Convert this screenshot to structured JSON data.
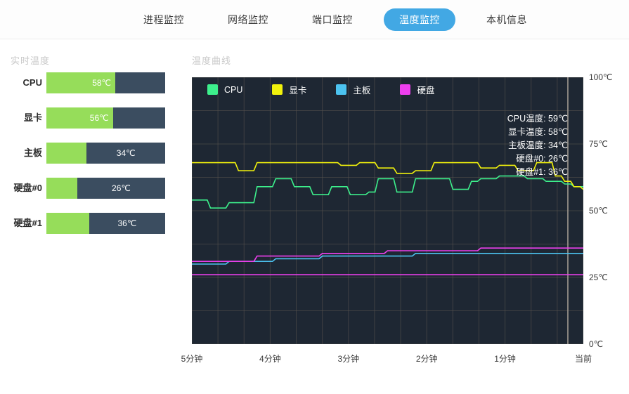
{
  "nav": {
    "items": [
      {
        "label": "进程监控",
        "active": false
      },
      {
        "label": "网络监控",
        "active": false
      },
      {
        "label": "端口监控",
        "active": false
      },
      {
        "label": "温度监控",
        "active": true
      },
      {
        "label": "本机信息",
        "active": false
      }
    ],
    "active_color": "#42a8e4"
  },
  "sidebar": {
    "title": "实时温度",
    "bar_fill_color": "#96dd5a",
    "bar_track_color": "#3b4d60",
    "bars": [
      {
        "label": "CPU",
        "value": "58℃",
        "percent": 58
      },
      {
        "label": "显卡",
        "value": "56℃",
        "percent": 56
      },
      {
        "label": "主板",
        "value": "34℃",
        "percent": 34
      },
      {
        "label": "硬盘#0",
        "value": "26℃",
        "percent": 26
      },
      {
        "label": "硬盘#1",
        "value": "36℃",
        "percent": 36
      }
    ]
  },
  "chart_panel": {
    "title": "温度曲线",
    "legend": [
      {
        "label": "CPU",
        "color": "#3df08c"
      },
      {
        "label": "显卡",
        "color": "#f2f20c"
      },
      {
        "label": "主板",
        "color": "#4cc3f0"
      },
      {
        "label": "硬盘",
        "color": "#ee3fee"
      }
    ],
    "readout": [
      "CPU温度: 59℃",
      "显卡温度: 58℃",
      "主板温度: 34℃",
      "硬盘#0: 26℃",
      "硬盘#1: 36℃"
    ]
  },
  "chart_data": {
    "type": "line",
    "title": "温度曲线",
    "xlabel": "",
    "ylabel": "",
    "ylim": [
      0,
      100
    ],
    "grid": true,
    "legend_position": "top-left",
    "background": "#1e2733",
    "gridline_color": "#5a5550",
    "y_ticks": [
      "100℃",
      "75℃",
      "50℃",
      "25℃",
      "0℃"
    ],
    "y_tick_values": [
      100,
      75,
      50,
      25,
      0
    ],
    "x_ticks": [
      "5分钟",
      "4分钟",
      "3分钟",
      "2分钟",
      "1分钟",
      "当前"
    ],
    "x_tick_values": [
      0,
      1,
      2,
      3,
      4,
      5
    ],
    "annotations": [
      "CPU温度: 59℃",
      "显卡温度: 58℃",
      "主板温度: 34℃",
      "硬盘#0: 26℃",
      "硬盘#1: 36℃"
    ],
    "series": [
      {
        "name": "CPU",
        "color": "#3df08c",
        "values": [
          54,
          54,
          51,
          51,
          53,
          53,
          53,
          59,
          59,
          62,
          62,
          59,
          59,
          56,
          56,
          59,
          59,
          56,
          56,
          57,
          62,
          62,
          57,
          57,
          62,
          62,
          62,
          62,
          58,
          58,
          61,
          62,
          62,
          63,
          63,
          63,
          62,
          62,
          61,
          61,
          60,
          59,
          59
        ]
      },
      {
        "name": "显卡",
        "color": "#f2f20c",
        "values": [
          68,
          68,
          68,
          68,
          68,
          65,
          65,
          68,
          68,
          68,
          68,
          68,
          68,
          68,
          68,
          68,
          67,
          67,
          68,
          68,
          66,
          66,
          64,
          64,
          65,
          65,
          68,
          68,
          68,
          68,
          68,
          66,
          66,
          67,
          67,
          65,
          65,
          68,
          68,
          63,
          61,
          59,
          58
        ]
      },
      {
        "name": "主板",
        "color": "#4cc3f0",
        "values": [
          30,
          30,
          30,
          30,
          31,
          31,
          31,
          31,
          31,
          32,
          32,
          32,
          32,
          32,
          33,
          33,
          33,
          33,
          33,
          33,
          33,
          33,
          33,
          33,
          34,
          34,
          34,
          34,
          34,
          34,
          34,
          34,
          34,
          34,
          34,
          34,
          34,
          34,
          34,
          34,
          34,
          34,
          34
        ]
      },
      {
        "name": "硬盘#0",
        "color": "#ee3fee",
        "values": [
          26,
          26,
          26,
          26,
          26,
          26,
          26,
          26,
          26,
          26,
          26,
          26,
          26,
          26,
          26,
          26,
          26,
          26,
          26,
          26,
          26,
          26,
          26,
          26,
          26,
          26,
          26,
          26,
          26,
          26,
          26,
          26,
          26,
          26,
          26,
          26,
          26,
          26,
          26,
          26,
          26,
          26,
          26
        ]
      },
      {
        "name": "硬盘#1",
        "color": "#ee3fee",
        "values": [
          31,
          31,
          31,
          31,
          31,
          31,
          31,
          33,
          33,
          33,
          33,
          33,
          33,
          33,
          34,
          34,
          34,
          34,
          34,
          34,
          34,
          35,
          35,
          35,
          35,
          35,
          35,
          35,
          35,
          35,
          35,
          36,
          36,
          36,
          36,
          36,
          36,
          36,
          36,
          36,
          36,
          36,
          36
        ]
      }
    ]
  }
}
